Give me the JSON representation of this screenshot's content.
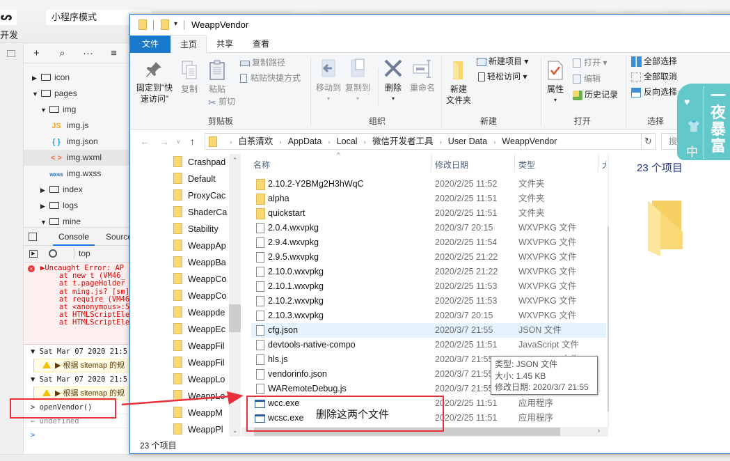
{
  "ide": {
    "dev_label": "开发",
    "mode_select": "小程序模式",
    "tree_toolbar": [
      "+",
      "⌕",
      "···",
      "≡"
    ],
    "tree": [
      {
        "label": "icon",
        "type": "folder",
        "expanded": false,
        "level": 0
      },
      {
        "label": "pages",
        "type": "folder",
        "expanded": true,
        "level": 0
      },
      {
        "label": "img",
        "type": "folder",
        "expanded": true,
        "level": 1
      },
      {
        "label": "img.js",
        "type": "js",
        "icon_text": "JS",
        "icon_color": "#f5a623",
        "level": 2
      },
      {
        "label": "img.json",
        "type": "json",
        "icon_text": "{ }",
        "icon_color": "#1a9bd8",
        "level": 2
      },
      {
        "label": "img.wxml",
        "type": "wxml",
        "icon_text": "< >",
        "icon_color": "#f26b2e",
        "level": 2,
        "selected": true
      },
      {
        "label": "img.wxss",
        "type": "wxss",
        "icon_text": "wxss",
        "icon_color": "#1a6fc2",
        "level": 2
      },
      {
        "label": "index",
        "type": "folder",
        "expanded": false,
        "level": 1
      },
      {
        "label": "logs",
        "type": "folder",
        "expanded": false,
        "level": 1
      },
      {
        "label": "mine",
        "type": "folder",
        "expanded": true,
        "level": 1
      }
    ],
    "console": {
      "tab_console": "Console",
      "tab_sources": "Sources",
      "context": "top",
      "error_lines": [
        "▶Uncaught Error: AP",
        "at new t (VM46_",
        "at t.pageHolder",
        "at ming.js? [sm]",
        "at require (VM46",
        "at <anonymous>:5",
        "at HTMLScriptEle",
        "at HTMLScriptEle"
      ],
      "group1_header": "▼ Sat Mar 07 2020 21:5",
      "group1_warning": "▶ 根据 sitemap 的规",
      "group2_header": "▼ Sat Mar 07 2020 21:5",
      "group2_warning": "▶ 根据 sitemap 的规",
      "command": "> openVendor()",
      "result": "← undefined",
      "prompt": ">"
    }
  },
  "explorer": {
    "title": "WeappVendor",
    "tabs": [
      "文件",
      "主页",
      "共享",
      "查看"
    ],
    "active_tab": "主页",
    "ribbon": {
      "clipboard": {
        "pin_line1": "固定到\"快",
        "pin_line2": "速访问\"",
        "copy": "复制",
        "paste": "粘贴",
        "copy_path": "复制路径",
        "paste_shortcut": "粘贴快捷方式",
        "cut": "剪切",
        "group": "剪贴板"
      },
      "organize": {
        "move_to": "移动到",
        "copy_to": "复制到",
        "delete": "删除",
        "rename": "重命名",
        "group": "组织"
      },
      "new": {
        "new_folder_line1": "新建",
        "new_folder_line2": "文件夹",
        "new_item": "新建项目 ▾",
        "easy_access": "轻松访问 ▾",
        "group": "新建"
      },
      "open": {
        "properties": "属性",
        "open": "打开 ▾",
        "edit": "编辑",
        "history": "历史记录",
        "group": "打开"
      },
      "select": {
        "select_all": "全部选择",
        "select_none": "全部取消",
        "invert": "反向选择",
        "group": "选择"
      }
    },
    "address": {
      "crumbs": [
        "白茶清欢",
        "AppData",
        "Local",
        "微信开发者工具",
        "User Data",
        "WeappVendor"
      ],
      "search_placeholder": "搜"
    },
    "nav_items": [
      "Crashpad",
      "Default",
      "ProxyCac",
      "ShaderCa",
      "Stability",
      "WeappAp",
      "WeappBa",
      "WeappCo",
      "WeappCo",
      "Weappde",
      "WeappEc",
      "WeappFil",
      "WeappFil",
      "WeappLo",
      "WeappLo",
      "WeappM",
      "WeappPl"
    ],
    "columns": {
      "name": "名称",
      "date": "修改日期",
      "type": "类型",
      "size": "大"
    },
    "files": [
      {
        "name": "2.10.2-Y2BMg2H3hWqC",
        "date": "2020/2/25 11:52",
        "type": "文件夹",
        "icon": "folder"
      },
      {
        "name": "alpha",
        "date": "2020/2/25 11:51",
        "type": "文件夹",
        "icon": "folder"
      },
      {
        "name": "quickstart",
        "date": "2020/2/25 11:51",
        "type": "文件夹",
        "icon": "folder"
      },
      {
        "name": "2.0.4.wxvpkg",
        "date": "2020/3/7 20:15",
        "type": "WXVPKG 文件",
        "icon": "file"
      },
      {
        "name": "2.9.4.wxvpkg",
        "date": "2020/2/25 11:54",
        "type": "WXVPKG 文件",
        "icon": "file"
      },
      {
        "name": "2.9.5.wxvpkg",
        "date": "2020/2/25 21:22",
        "type": "WXVPKG 文件",
        "icon": "file"
      },
      {
        "name": "2.10.0.wxvpkg",
        "date": "2020/2/25 21:22",
        "type": "WXVPKG 文件",
        "icon": "file"
      },
      {
        "name": "2.10.1.wxvpkg",
        "date": "2020/2/25 11:53",
        "type": "WXVPKG 文件",
        "icon": "file"
      },
      {
        "name": "2.10.2.wxvpkg",
        "date": "2020/2/25 11:53",
        "type": "WXVPKG 文件",
        "icon": "file"
      },
      {
        "name": "2.10.3.wxvpkg",
        "date": "2020/3/7 20:15",
        "type": "WXVPKG 文件",
        "icon": "file"
      },
      {
        "name": "cfg.json",
        "date": "2020/3/7 21:55",
        "type": "JSON 文件",
        "icon": "file",
        "hover": true
      },
      {
        "name": "devtools-native-compo",
        "date": "2020/2/25 11:51",
        "type": "JavaScript 文件",
        "icon": "file"
      },
      {
        "name": "hls.js",
        "date": "2020/3/7 21:55",
        "type": "JavaScript 文件",
        "icon": "file"
      },
      {
        "name": "vendorinfo.json",
        "date": "2020/3/7 21:55",
        "type": "JSON 文件",
        "icon": "file"
      },
      {
        "name": "WARemoteDebug.js",
        "date": "2020/3/7 21:55",
        "type": "JavaScript 文件",
        "icon": "file"
      },
      {
        "name": "wcc.exe",
        "date": "2020/2/25 11:51",
        "type": "应用程序",
        "icon": "exe"
      },
      {
        "name": "wcsc.exe",
        "date": "2020/2/25 11:51",
        "type": "应用程序",
        "icon": "exe"
      }
    ],
    "tooltip": {
      "type": "类型: JSON 文件",
      "size": "大小: 1.45 KB",
      "modified": "修改日期: 2020/3/7 21:55"
    },
    "preview_count": "23 个项目",
    "status": "23 个项目"
  },
  "annotation": {
    "text": "删除这两个文件",
    "color": "#e8303a"
  },
  "watermark": {
    "chars": [
      "一",
      "夜",
      "暴",
      "富"
    ],
    "small": "中",
    "color": "#63c8c9"
  }
}
